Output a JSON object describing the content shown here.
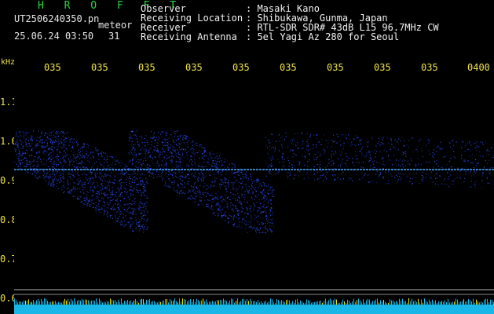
{
  "header": {
    "brand": "H R O F F T",
    "filename": "UT2506240350.pn",
    "meteor_label": "meteor",
    "datetime": "25.06.24 03:50",
    "count": "31"
  },
  "info": [
    {
      "label": "Observer",
      "value": ": Masaki Kano"
    },
    {
      "label": "Receiving Location",
      "value": ": Shibukawa, Gunma, Japan"
    },
    {
      "label": "Receiver",
      "value": ": RTL-SDR SDR# 43dB L15 96.7MHz CW"
    },
    {
      "label": "Receiving Antenna",
      "value": ": 5el Yagi Az 280 for Seoul"
    }
  ],
  "axis": {
    "y_unit": "kHz",
    "y_ticks": [
      "1.1",
      "1.0",
      "0.9",
      "0.8",
      "0.7",
      "0.6"
    ],
    "x_ticks": [
      "035",
      "035",
      "035",
      "035",
      "035",
      "035",
      "035",
      "035",
      "035",
      "0400"
    ]
  },
  "colors": {
    "background": "#000000",
    "brand": "#25d63e",
    "axis_text": "#f0e24a",
    "echo": "#2a4fff",
    "carrier": "#4aa6ff",
    "noise_floor": "#19b7e8",
    "spike": "#f2e600"
  }
}
